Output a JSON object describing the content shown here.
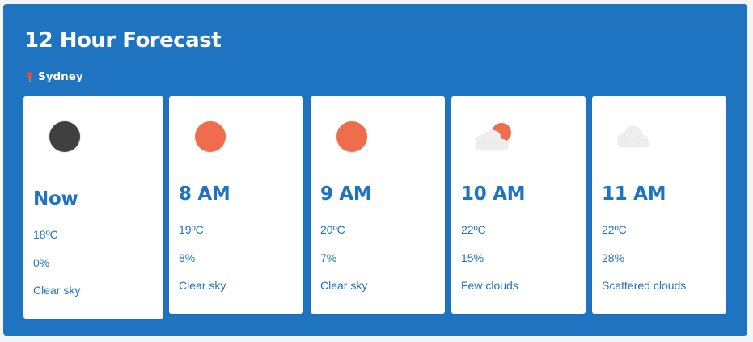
{
  "header": {
    "title": "12 Hour Forecast",
    "location": "Sydney"
  },
  "colors": {
    "panel": "#1f74c1",
    "text_accent": "#1f74c1",
    "sun": "#ef6c4c",
    "moon": "#404040",
    "cloud": "#eeeeee"
  },
  "forecast": [
    {
      "time": "Now",
      "temp": "18ºC",
      "precip": "0%",
      "desc": "Clear sky",
      "icon": "moon-icon"
    },
    {
      "time": "8 AM",
      "temp": "19ºC",
      "precip": "8%",
      "desc": "Clear sky",
      "icon": "sun-icon"
    },
    {
      "time": "9 AM",
      "temp": "20ºC",
      "precip": "7%",
      "desc": "Clear sky",
      "icon": "sun-icon"
    },
    {
      "time": "10 AM",
      "temp": "22ºC",
      "precip": "15%",
      "desc": "Few clouds",
      "icon": "sun-cloud-icon"
    },
    {
      "time": "11 AM",
      "temp": "22ºC",
      "precip": "28%",
      "desc": "Scattered clouds",
      "icon": "cloud-icon"
    }
  ]
}
